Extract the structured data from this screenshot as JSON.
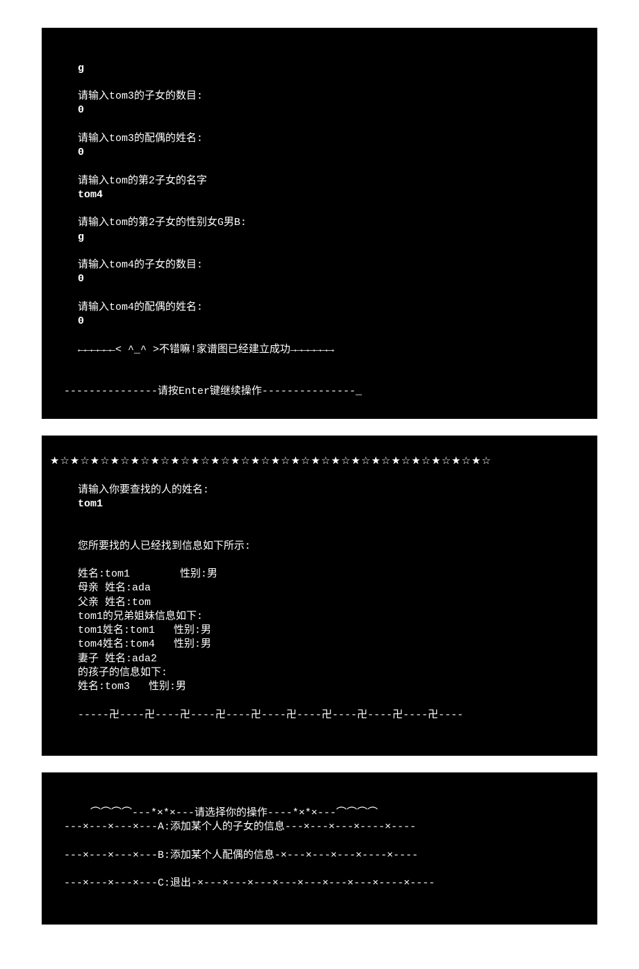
{
  "panel1": {
    "l0": "g",
    "p1": "请输入tom3的子女的数目:",
    "a1": "0",
    "p2": "请输入tom3的配偶的姓名:",
    "a2": "0",
    "p3": "请输入tom的第2子女的名字",
    "a3": "tom4",
    "p4": "请输入tom的第2子女的性别女G男B:",
    "a4": "g",
    "p5": "请输入tom4的子女的数目:",
    "a5": "0",
    "p6": "请输入tom4的配偶的姓名:",
    "a6": "0",
    "success": "←←←←←←< ^_^ >不错嘛!家谱图已经建立成功→→→→→→→",
    "continue": "---------------请按Enter键继续操作---------------_"
  },
  "panel2": {
    "stars": "★☆★☆★☆★☆★☆★☆★☆★☆★☆★☆★☆★☆★☆★☆★☆★☆★☆★☆★☆★☆★☆★☆",
    "search_prompt": "请输入你要查找的人的姓名:",
    "search_input": "tom1",
    "found": "您所要找的人已经找到信息如下所示:",
    "r1": "姓名:tom1        性别:男",
    "r2": "母亲 姓名:ada",
    "r3": "父亲 姓名:tom",
    "r4": "tom1的兄弟姐妹信息如下:",
    "r5": "tom1姓名:tom1   性别:男",
    "r6": "tom4姓名:tom4   性别:男",
    "r7": "妻子 姓名:ada2",
    "r8": "的孩子的信息如下:",
    "r9": "姓名:tom3   性别:男",
    "divider": "-----卍----卍----卍----卍----卍----卍----卍----卍----卍----卍----"
  },
  "panel3": {
    "m1": "  ⌒⌒⌒⌒---*×*×---请选择你的操作----*×*×---⌒⌒⌒⌒",
    "m2": "---×---×---×---A:添加某个人的子女的信息---×---×---×----×----",
    "m3": "---×---×---×---B:添加某个人配偶的信息-×---×---×---×----×----",
    "m4": "---×---×---×---C:退出-×---×---×---×---×---×---×---×----×----"
  }
}
